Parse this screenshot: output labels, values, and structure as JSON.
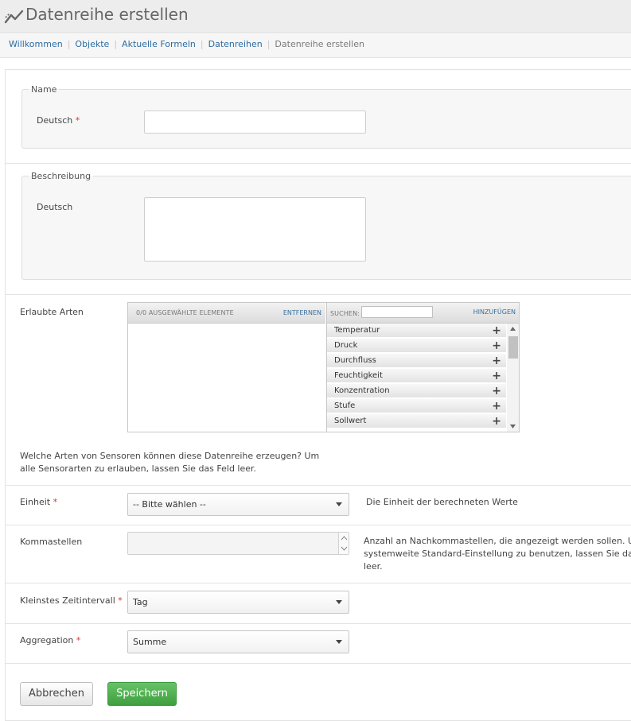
{
  "header": {
    "title": "Datenreihe erstellen",
    "icon": "chart-line-icon"
  },
  "breadcrumb": {
    "items": [
      "Willkommen",
      "Objekte",
      "Aktuelle Formeln",
      "Datenreihen"
    ],
    "current": "Datenreihe erstellen",
    "separator": "|"
  },
  "name_section": {
    "legend": "Name",
    "field_label": "Deutsch",
    "required_mark": "*",
    "value": ""
  },
  "description_section": {
    "legend": "Beschreibung",
    "field_label": "Deutsch",
    "value": ""
  },
  "allowed_types": {
    "label": "Erlaubte Arten",
    "selected_caption": "0/0 AUSGEWÄHLTE ELEMENTE",
    "remove_label": "ENTFERNEN",
    "search_label": "SUCHEN:",
    "search_value": "",
    "add_label": "HINZUFÜGEN",
    "options": [
      "Temperatur",
      "Druck",
      "Durchfluss",
      "Feuchtigkeit",
      "Konzentration",
      "Stufe",
      "Sollwert"
    ],
    "add_icon": "plus-icon",
    "help_line1": "Welche Arten von Sensoren können diese Datenreihe erzeugen? Um",
    "help_line2": "alle Sensorarten zu erlauben, lassen Sie das Feld leer."
  },
  "unit": {
    "label": "Einheit",
    "required_mark": "*",
    "value": "-- Bitte wählen --",
    "help": "Die Einheit der berechneten Werte"
  },
  "decimals": {
    "label": "Kommastellen",
    "value": "",
    "help_line1": "Anzahl an Nachkommastellen, die angezeigt werden sollen. Um die",
    "help_line2": "systemweite Standard-Einstellung zu benutzen, lassen Sie das Feld",
    "help_line3": "leer."
  },
  "interval": {
    "label": "Kleinstes Zeitintervall",
    "required_mark": "*",
    "value": "Tag"
  },
  "aggregation": {
    "label": "Aggregation",
    "required_mark": "*",
    "value": "Summe"
  },
  "buttons": {
    "cancel": "Abbrechen",
    "save": "Speichern"
  },
  "colors": {
    "link": "#2d6ca2",
    "required": "#dd3333",
    "save_button": "#4caf50"
  }
}
